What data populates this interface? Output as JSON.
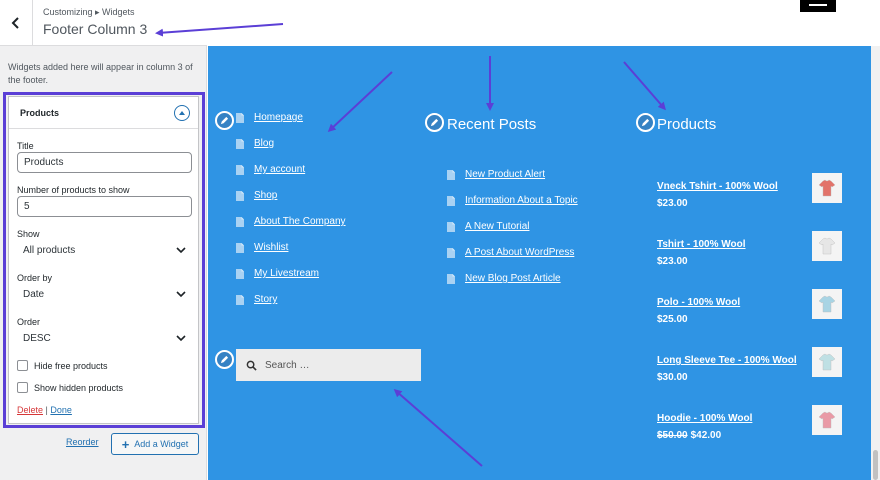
{
  "sidebar": {
    "breadcrumb": "Customizing ▸ Widgets",
    "title": "Footer Column 3",
    "description": "Widgets added here will appear in column 3 of the footer.",
    "reorder_label": "Reorder",
    "add_widget_label": "Add a Widget"
  },
  "widget": {
    "name": "Products",
    "title_label": "Title",
    "title_value": "Products",
    "count_label": "Number of products to show",
    "count_value": "5",
    "show_label": "Show",
    "show_value": "All products",
    "orderby_label": "Order by",
    "orderby_value": "Date",
    "order_label": "Order",
    "order_value": "DESC",
    "hide_free_label": "Hide free products",
    "show_hidden_label": "Show hidden products",
    "delete_label": "Delete",
    "separator": "|",
    "done_label": "Done"
  },
  "footer": {
    "nav_items": [
      "Homepage",
      "Blog",
      "My account",
      "Shop",
      "About The Company",
      "Wishlist",
      "My Livestream",
      "Story"
    ],
    "recent_posts_title": "Recent Posts",
    "recent_posts": [
      "New Product Alert",
      "Information About a Topic",
      "A New Tutorial",
      "A Post About WordPress",
      "New Blog Post Article"
    ],
    "products_title": "Products",
    "products": [
      {
        "name": "Vneck Tshirt - 100% Wool",
        "price": "$23.00",
        "old_price": "",
        "color": "#e2736a"
      },
      {
        "name": "Tshirt - 100% Wool",
        "price": "$23.00",
        "old_price": "",
        "color": "#e6e6e6"
      },
      {
        "name": "Polo - 100% Wool",
        "price": "$25.00",
        "old_price": "",
        "color": "#a8d4e4"
      },
      {
        "name": "Long Sleeve Tee - 100% Wool",
        "price": "$30.00",
        "old_price": "",
        "color": "#bfe0e4"
      },
      {
        "name": "Hoodie - 100% Wool",
        "price": "$42.00",
        "old_price": "$50.00",
        "color": "#e99aa6"
      }
    ],
    "search_placeholder": "Search …"
  },
  "colors": {
    "footer_bg": "#2f94e4",
    "annotation": "#5b3fd6",
    "link": "#2271b1",
    "delete": "#d63638"
  }
}
